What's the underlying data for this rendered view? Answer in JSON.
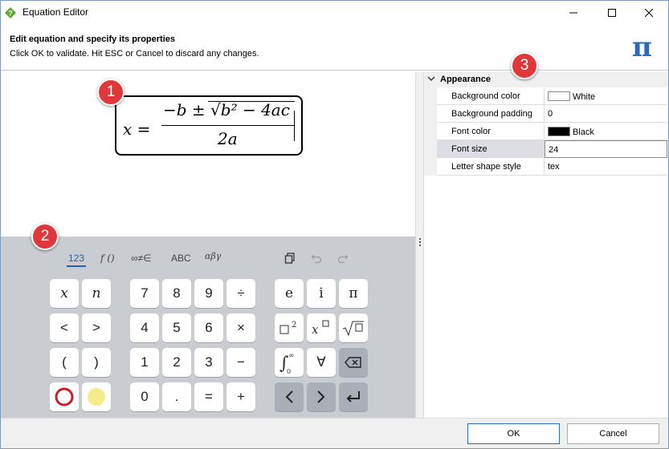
{
  "window": {
    "title": "Equation Editor"
  },
  "header": {
    "title": "Edit equation and specify its properties",
    "subtitle": "Click OK to validate. Hit ESC or Cancel to discard any changes.",
    "logo_glyph": "π"
  },
  "equation": {
    "lhs": "x =",
    "numerator": "−b ± √",
    "radicand": "b² − 4ac",
    "denominator": "2a"
  },
  "keyboard": {
    "tabs": [
      "123",
      "f ()",
      "∞≠∈",
      "ABC",
      "αβγ"
    ],
    "active_tab": "123",
    "keys_left": [
      "x",
      "n",
      "<",
      ">",
      "(",
      ")"
    ],
    "keys_num": [
      "7",
      "8",
      "9",
      "÷",
      "4",
      "5",
      "6",
      "×",
      "1",
      "2",
      "3",
      "−",
      "0",
      ".",
      "=",
      "+"
    ],
    "keys_right": [
      "e",
      "i",
      "π",
      "□²",
      "x□",
      "√□",
      "∫₀^∞",
      "∀"
    ],
    "toolbar_icons": [
      "copy-icon",
      "undo-icon",
      "redo-icon"
    ]
  },
  "properties": {
    "category": "Appearance",
    "rows": [
      {
        "name": "Background color",
        "value": "White",
        "swatch": "#ffffff"
      },
      {
        "name": "Background padding",
        "value": "0"
      },
      {
        "name": "Font color",
        "value": "Black",
        "swatch": "#000000"
      },
      {
        "name": "Font size",
        "value": "24"
      },
      {
        "name": "Letter shape style",
        "value": "tex"
      }
    ]
  },
  "footer": {
    "ok_label": "OK",
    "cancel_label": "Cancel"
  },
  "callouts": [
    "1",
    "2",
    "3"
  ],
  "colors": {
    "callout": "#e0383a",
    "accent": "#2a5ea8",
    "keyboard_bg": "#c9ccd1"
  }
}
